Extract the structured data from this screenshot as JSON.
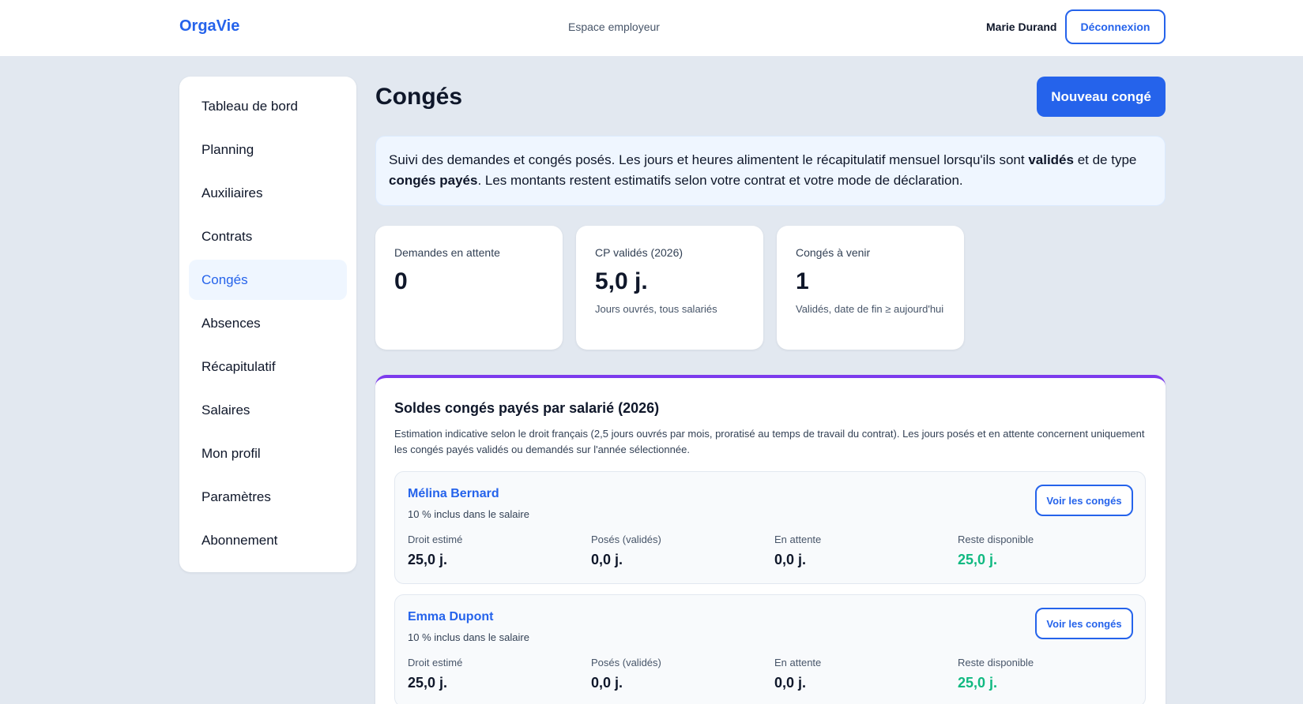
{
  "header": {
    "brand": "OrgaVie",
    "space": "Espace employeur",
    "user_name": "Marie Durand",
    "logout_label": "Déconnexion"
  },
  "sidebar": {
    "items": [
      {
        "label": "Tableau de bord"
      },
      {
        "label": "Planning"
      },
      {
        "label": "Auxiliaires"
      },
      {
        "label": "Contrats"
      },
      {
        "label": "Congés",
        "active": true
      },
      {
        "label": "Absences"
      },
      {
        "label": "Récapitulatif"
      },
      {
        "label": "Salaires"
      },
      {
        "label": "Mon profil"
      },
      {
        "label": "Paramètres"
      },
      {
        "label": "Abonnement"
      }
    ]
  },
  "main": {
    "title": "Congés",
    "new_button": "Nouveau congé",
    "info": {
      "part1": "Suivi des demandes et congés posés. Les jours et heures alimentent le récapitulatif mensuel lorsqu'ils sont ",
      "bold1": "validés",
      "part2": " et de type ",
      "bold2": "congés payés",
      "part3": ". Les montants restent estimatifs selon votre contrat et votre mode de déclaration."
    },
    "stats": [
      {
        "label": "Demandes en attente",
        "value": "0",
        "sub": ""
      },
      {
        "label": "CP validés (2026)",
        "value": "5,0 j.",
        "sub": "Jours ouvrés, tous salariés"
      },
      {
        "label": "Congés à venir",
        "value": "1",
        "sub": "Validés, date de fin ≥ aujourd'hui"
      }
    ],
    "balances": {
      "title": "Soldes congés payés par salarié (2026)",
      "description": "Estimation indicative selon le droit français (2,5 jours ouvrés par mois, proratisé au temps de travail du contrat). Les jours posés et en attente concernent uniquement les congés payés validés ou demandés sur l'année sélectionnée.",
      "metric_labels": {
        "entitled": "Droit estimé",
        "taken": "Posés (validés)",
        "pending": "En attente",
        "remaining": "Reste disponible"
      },
      "view_label": "Voir les congés",
      "employees": [
        {
          "name": "Mélina Bernard",
          "note": "10 % inclus dans le salaire",
          "entitled": "25,0 j.",
          "taken": "0,0 j.",
          "pending": "0,0 j.",
          "remaining": "25,0 j."
        },
        {
          "name": "Emma Dupont",
          "note": "10 % inclus dans le salaire",
          "entitled": "25,0 j.",
          "taken": "0,0 j.",
          "pending": "0,0 j.",
          "remaining": "25,0 j."
        }
      ]
    }
  },
  "colors": {
    "accent": "#2563eb",
    "balance_border": "#7c3aed",
    "remaining_green": "#10b981",
    "background": "#e2e8f0"
  }
}
